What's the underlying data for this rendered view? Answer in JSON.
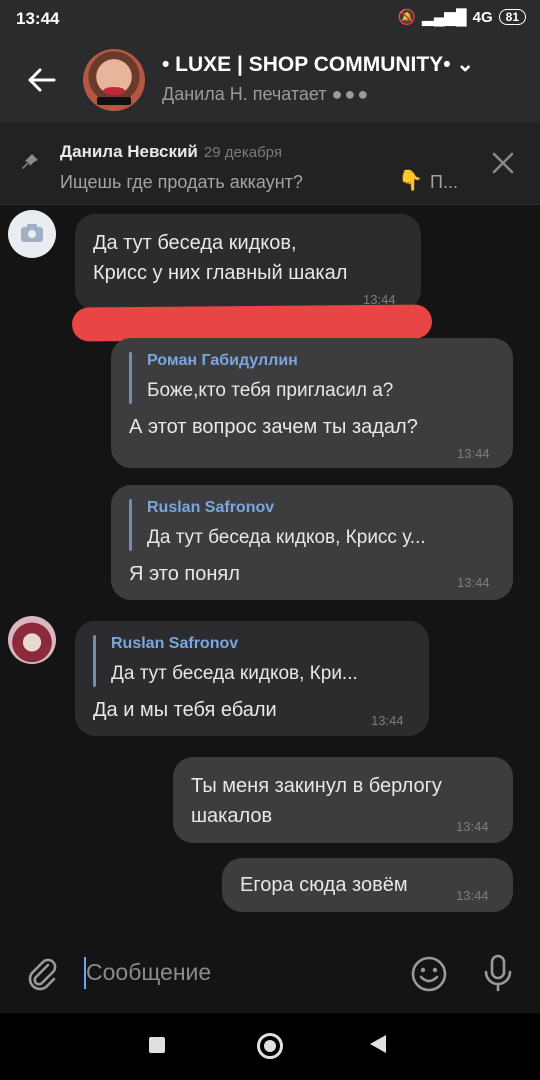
{
  "status": {
    "time": "13:44",
    "network": "4G",
    "battery": "81"
  },
  "header": {
    "title": "• LUXE | SHOP COMMUNITY•",
    "subtitle": "Данила Н. печатает",
    "typing_dots": "●●●"
  },
  "pinned": {
    "author": "Данила Невский",
    "date": "29 декабря",
    "text": "Ищешь где продать аккаунт?",
    "emoji": "👇",
    "more": "П..."
  },
  "messages": [
    {
      "lines": [
        "Да тут беседа кидков,",
        "Крисс у них главный шакал"
      ],
      "time": "13:44"
    },
    {
      "reply_name": "Роман Габидуллин",
      "reply_text": "Боже,кто тебя пригласил а?",
      "text": "А этот вопрос зачем ты задал?",
      "time": "13:44"
    },
    {
      "reply_name": "Ruslan Safronov",
      "reply_text": "Да тут беседа кидков, Крисс у...",
      "text": "Я это понял",
      "time": "13:44"
    },
    {
      "reply_name": "Ruslan Safronov",
      "reply_text": "Да тут беседа кидков, Кри...",
      "text": "Да и мы тебя ебали",
      "time": "13:44"
    },
    {
      "lines": [
        "Ты меня закинул в берлогу",
        "шакалов"
      ],
      "time": "13:44"
    },
    {
      "text": "Егора сюда зовём",
      "time": "13:44"
    }
  ],
  "input": {
    "placeholder": "Сообщение"
  },
  "colors": {
    "accent": "#7aa7e0",
    "redaction": "#e84545",
    "bubble": "#3a3a3c"
  },
  "icons": [
    "back-arrow-icon",
    "pin-icon",
    "close-icon",
    "camera-icon",
    "attach-icon",
    "emoji-icon",
    "mic-icon"
  ]
}
